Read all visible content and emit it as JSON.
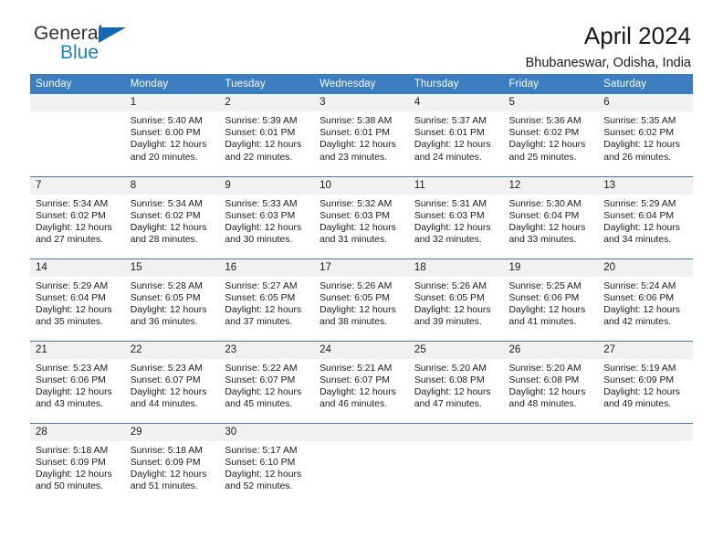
{
  "brand": {
    "name_top": "General",
    "name_bottom": "Blue",
    "triangle_icon": "blue-triangle-icon",
    "color_dark": "#313131",
    "color_blue": "#1b7fc4"
  },
  "header": {
    "title": "April 2024",
    "subtitle": "Bhubaneswar, Odisha, India"
  },
  "theme": {
    "header_bg": "#3b7dc1",
    "header_text": "#ffffff",
    "daynum_bg": "#f1f1f1",
    "row_divider": "#3b7dc1",
    "body_text": "#1a1a1a"
  },
  "calendar": {
    "weekday_headers": [
      "Sunday",
      "Monday",
      "Tuesday",
      "Wednesday",
      "Thursday",
      "Friday",
      "Saturday"
    ],
    "weeks": [
      [
        {
          "day": "",
          "empty": true,
          "sunrise": "",
          "sunset": "",
          "daylight": ""
        },
        {
          "day": "1",
          "sunrise": "Sunrise: 5:40 AM",
          "sunset": "Sunset: 6:00 PM",
          "daylight": "Daylight: 12 hours and 20 minutes."
        },
        {
          "day": "2",
          "sunrise": "Sunrise: 5:39 AM",
          "sunset": "Sunset: 6:01 PM",
          "daylight": "Daylight: 12 hours and 22 minutes."
        },
        {
          "day": "3",
          "sunrise": "Sunrise: 5:38 AM",
          "sunset": "Sunset: 6:01 PM",
          "daylight": "Daylight: 12 hours and 23 minutes."
        },
        {
          "day": "4",
          "sunrise": "Sunrise: 5:37 AM",
          "sunset": "Sunset: 6:01 PM",
          "daylight": "Daylight: 12 hours and 24 minutes."
        },
        {
          "day": "5",
          "sunrise": "Sunrise: 5:36 AM",
          "sunset": "Sunset: 6:02 PM",
          "daylight": "Daylight: 12 hours and 25 minutes."
        },
        {
          "day": "6",
          "sunrise": "Sunrise: 5:35 AM",
          "sunset": "Sunset: 6:02 PM",
          "daylight": "Daylight: 12 hours and 26 minutes."
        }
      ],
      [
        {
          "day": "7",
          "sunrise": "Sunrise: 5:34 AM",
          "sunset": "Sunset: 6:02 PM",
          "daylight": "Daylight: 12 hours and 27 minutes."
        },
        {
          "day": "8",
          "sunrise": "Sunrise: 5:34 AM",
          "sunset": "Sunset: 6:02 PM",
          "daylight": "Daylight: 12 hours and 28 minutes."
        },
        {
          "day": "9",
          "sunrise": "Sunrise: 5:33 AM",
          "sunset": "Sunset: 6:03 PM",
          "daylight": "Daylight: 12 hours and 30 minutes."
        },
        {
          "day": "10",
          "sunrise": "Sunrise: 5:32 AM",
          "sunset": "Sunset: 6:03 PM",
          "daylight": "Daylight: 12 hours and 31 minutes."
        },
        {
          "day": "11",
          "sunrise": "Sunrise: 5:31 AM",
          "sunset": "Sunset: 6:03 PM",
          "daylight": "Daylight: 12 hours and 32 minutes."
        },
        {
          "day": "12",
          "sunrise": "Sunrise: 5:30 AM",
          "sunset": "Sunset: 6:04 PM",
          "daylight": "Daylight: 12 hours and 33 minutes."
        },
        {
          "day": "13",
          "sunrise": "Sunrise: 5:29 AM",
          "sunset": "Sunset: 6:04 PM",
          "daylight": "Daylight: 12 hours and 34 minutes."
        }
      ],
      [
        {
          "day": "14",
          "sunrise": "Sunrise: 5:29 AM",
          "sunset": "Sunset: 6:04 PM",
          "daylight": "Daylight: 12 hours and 35 minutes."
        },
        {
          "day": "15",
          "sunrise": "Sunrise: 5:28 AM",
          "sunset": "Sunset: 6:05 PM",
          "daylight": "Daylight: 12 hours and 36 minutes."
        },
        {
          "day": "16",
          "sunrise": "Sunrise: 5:27 AM",
          "sunset": "Sunset: 6:05 PM",
          "daylight": "Daylight: 12 hours and 37 minutes."
        },
        {
          "day": "17",
          "sunrise": "Sunrise: 5:26 AM",
          "sunset": "Sunset: 6:05 PM",
          "daylight": "Daylight: 12 hours and 38 minutes."
        },
        {
          "day": "18",
          "sunrise": "Sunrise: 5:26 AM",
          "sunset": "Sunset: 6:05 PM",
          "daylight": "Daylight: 12 hours and 39 minutes."
        },
        {
          "day": "19",
          "sunrise": "Sunrise: 5:25 AM",
          "sunset": "Sunset: 6:06 PM",
          "daylight": "Daylight: 12 hours and 41 minutes."
        },
        {
          "day": "20",
          "sunrise": "Sunrise: 5:24 AM",
          "sunset": "Sunset: 6:06 PM",
          "daylight": "Daylight: 12 hours and 42 minutes."
        }
      ],
      [
        {
          "day": "21",
          "sunrise": "Sunrise: 5:23 AM",
          "sunset": "Sunset: 6:06 PM",
          "daylight": "Daylight: 12 hours and 43 minutes."
        },
        {
          "day": "22",
          "sunrise": "Sunrise: 5:23 AM",
          "sunset": "Sunset: 6:07 PM",
          "daylight": "Daylight: 12 hours and 44 minutes."
        },
        {
          "day": "23",
          "sunrise": "Sunrise: 5:22 AM",
          "sunset": "Sunset: 6:07 PM",
          "daylight": "Daylight: 12 hours and 45 minutes."
        },
        {
          "day": "24",
          "sunrise": "Sunrise: 5:21 AM",
          "sunset": "Sunset: 6:07 PM",
          "daylight": "Daylight: 12 hours and 46 minutes."
        },
        {
          "day": "25",
          "sunrise": "Sunrise: 5:20 AM",
          "sunset": "Sunset: 6:08 PM",
          "daylight": "Daylight: 12 hours and 47 minutes."
        },
        {
          "day": "26",
          "sunrise": "Sunrise: 5:20 AM",
          "sunset": "Sunset: 6:08 PM",
          "daylight": "Daylight: 12 hours and 48 minutes."
        },
        {
          "day": "27",
          "sunrise": "Sunrise: 5:19 AM",
          "sunset": "Sunset: 6:09 PM",
          "daylight": "Daylight: 12 hours and 49 minutes."
        }
      ],
      [
        {
          "day": "28",
          "sunrise": "Sunrise: 5:18 AM",
          "sunset": "Sunset: 6:09 PM",
          "daylight": "Daylight: 12 hours and 50 minutes."
        },
        {
          "day": "29",
          "sunrise": "Sunrise: 5:18 AM",
          "sunset": "Sunset: 6:09 PM",
          "daylight": "Daylight: 12 hours and 51 minutes."
        },
        {
          "day": "30",
          "sunrise": "Sunrise: 5:17 AM",
          "sunset": "Sunset: 6:10 PM",
          "daylight": "Daylight: 12 hours and 52 minutes."
        },
        {
          "day": "",
          "empty": true,
          "sunrise": "",
          "sunset": "",
          "daylight": ""
        },
        {
          "day": "",
          "empty": true,
          "sunrise": "",
          "sunset": "",
          "daylight": ""
        },
        {
          "day": "",
          "empty": true,
          "sunrise": "",
          "sunset": "",
          "daylight": ""
        },
        {
          "day": "",
          "empty": true,
          "sunrise": "",
          "sunset": "",
          "daylight": ""
        }
      ]
    ]
  }
}
